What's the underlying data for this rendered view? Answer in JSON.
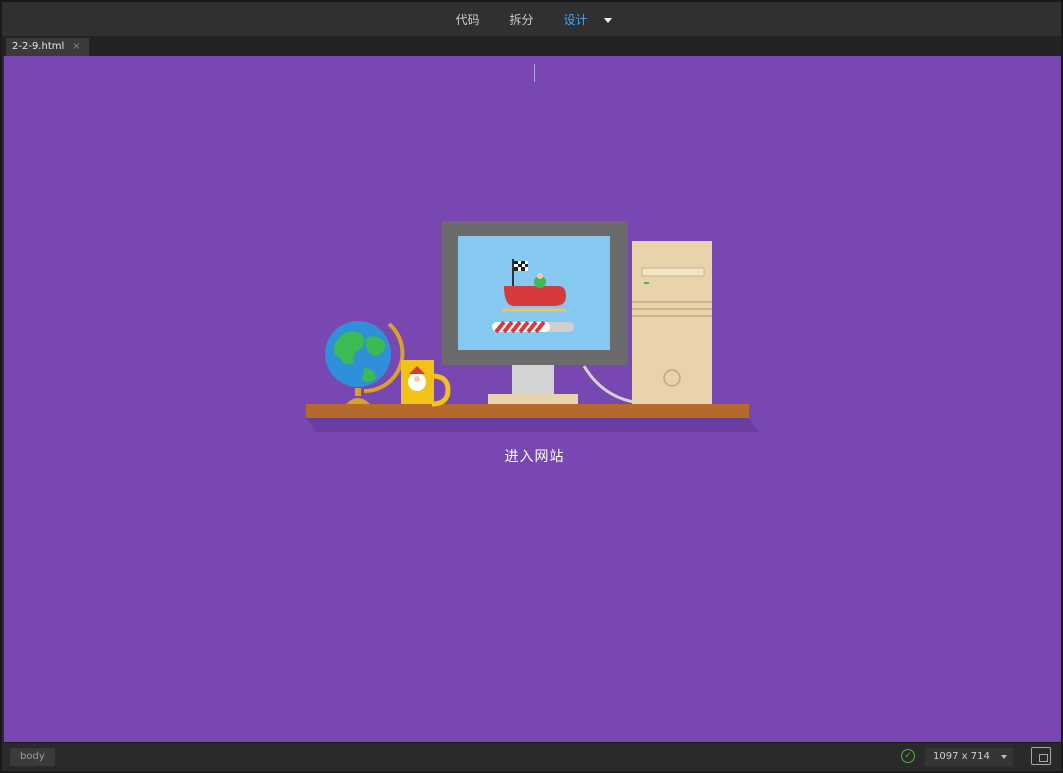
{
  "topbar": {
    "views": [
      {
        "label": "代码",
        "active": false
      },
      {
        "label": "拆分",
        "active": false
      },
      {
        "label": "设计",
        "active": true
      }
    ],
    "dropdown_icon": "caret-down-icon"
  },
  "tab": {
    "filename": "2-2-9.html",
    "close_icon": "close-icon"
  },
  "canvas": {
    "background": "#7847b1",
    "link_text": "进入网站"
  },
  "statusbar": {
    "tag": "body",
    "status_icon": "check-circle-icon",
    "size": "1097 x 714",
    "preview_icon": "preview-icon"
  },
  "colors": {
    "accent": "#3fa9f5",
    "active_underline": "#d0202a",
    "shelf": "#b56a2b",
    "monitor": "#6b6b6b",
    "screen": "#86c9f0",
    "tower": "#e8d3aa"
  }
}
